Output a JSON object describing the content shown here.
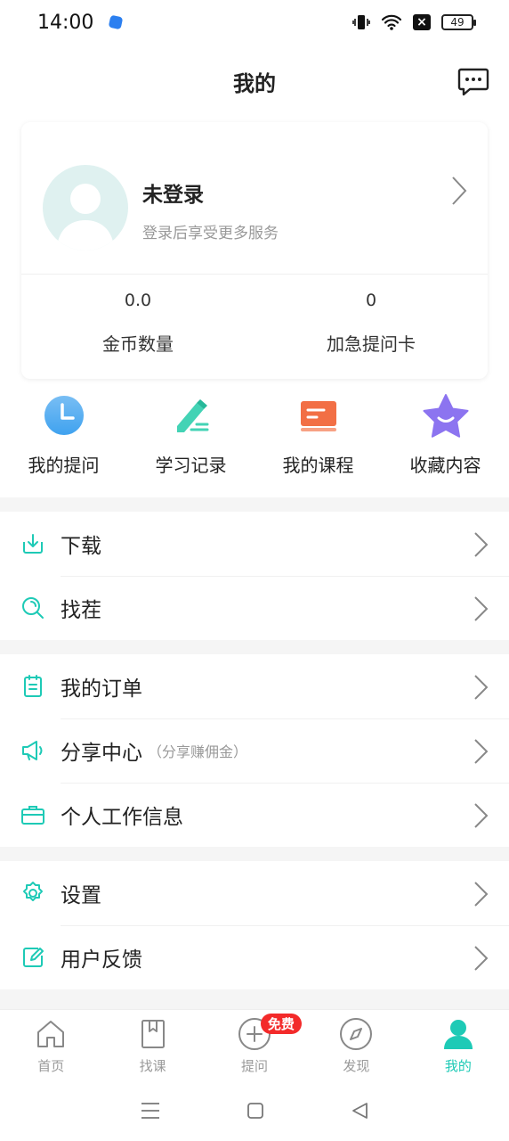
{
  "status": {
    "time": "14:00",
    "battery": "49"
  },
  "header": {
    "title": "我的"
  },
  "profile": {
    "name": "未登录",
    "subtitle": "登录后享受更多服务"
  },
  "stats": [
    {
      "value": "0.0",
      "label": "金币数量"
    },
    {
      "value": "0",
      "label": "加急提问卡"
    }
  ],
  "quick": [
    {
      "label": "我的提问",
      "icon": "clock-icon"
    },
    {
      "label": "学习记录",
      "icon": "pencil-icon"
    },
    {
      "label": "我的课程",
      "icon": "course-book-icon"
    },
    {
      "label": "收藏内容",
      "icon": "star-icon"
    }
  ],
  "menu": {
    "download": "下载",
    "find_fault": "找茬",
    "orders": "我的订单",
    "share": "分享中心",
    "share_hint": "（分享赚佣金）",
    "work_info": "个人工作信息",
    "settings": "设置",
    "feedback": "用户反馈"
  },
  "tabs": [
    {
      "label": "首页",
      "icon": "home-icon"
    },
    {
      "label": "找课",
      "icon": "book-icon"
    },
    {
      "label": "提问",
      "icon": "plus-circle-icon"
    },
    {
      "label": "发现",
      "icon": "compass-icon"
    },
    {
      "label": "我的",
      "icon": "person-icon"
    }
  ],
  "ask_badge": "免费",
  "colors": {
    "accent": "#1ecab6",
    "badge": "#f32a2a",
    "clock": "#3fa2ef",
    "course": "#f26f45",
    "star": "#8c74f0"
  }
}
